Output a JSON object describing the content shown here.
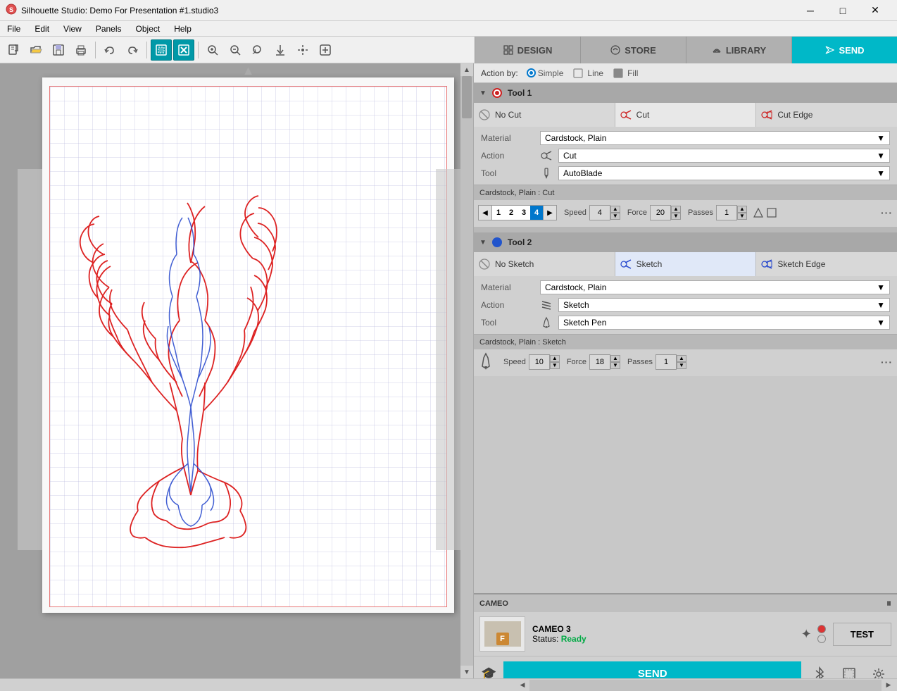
{
  "titlebar": {
    "title": "Silhouette Studio: Demo For Presentation #1.studio3",
    "minimize": "─",
    "maximize": "□",
    "close": "✕"
  },
  "menubar": {
    "items": [
      "File",
      "Edit",
      "View",
      "Panels",
      "Object",
      "Help"
    ]
  },
  "toolbar": {
    "buttons": [
      "new",
      "open",
      "save",
      "print",
      "undo",
      "redo",
      "select",
      "deselect",
      "zoom-in",
      "zoom-out",
      "zoom-fit",
      "move-down",
      "pan",
      "add"
    ]
  },
  "topnav": {
    "tabs": [
      {
        "id": "design",
        "label": "DESIGN",
        "icon": "grid"
      },
      {
        "id": "store",
        "label": "STORE",
        "icon": "store"
      },
      {
        "id": "library",
        "label": "LIBRARY",
        "icon": "cloud"
      },
      {
        "id": "send",
        "label": "SEND",
        "icon": "send",
        "active": true
      }
    ]
  },
  "action_by": {
    "label": "Action by:",
    "options": [
      "Simple",
      "Line",
      "Fill"
    ],
    "active": "Simple"
  },
  "tool1": {
    "header": "Tool 1",
    "cut_options": [
      {
        "id": "no-cut",
        "label": "No Cut"
      },
      {
        "id": "cut",
        "label": "Cut",
        "selected": true
      },
      {
        "id": "cut-edge",
        "label": "Cut Edge"
      }
    ],
    "material_label": "Material",
    "material_value": "Cardstock, Plain",
    "action_label": "Action",
    "action_value": "Cut",
    "tool_label": "Tool",
    "tool_value": "AutoBlade",
    "settings_label": "Cardstock, Plain : Cut",
    "speed_label": "Speed",
    "speed_value": "4",
    "force_label": "Force",
    "force_value": "20",
    "passes_label": "Passes",
    "passes_value": "1",
    "depth_levels": [
      "1",
      "2",
      "3",
      "4"
    ],
    "active_depth": "4"
  },
  "tool2": {
    "header": "Tool 2",
    "sketch_options": [
      {
        "id": "no-sketch",
        "label": "No Sketch"
      },
      {
        "id": "sketch",
        "label": "Sketch",
        "selected": true
      },
      {
        "id": "sketch-edge",
        "label": "Sketch Edge"
      }
    ],
    "material_label": "Material",
    "material_value": "Cardstock, Plain",
    "action_label": "Action",
    "action_value": "Sketch",
    "tool_label": "Tool",
    "tool_value": "Sketch Pen",
    "settings_label": "Cardstock, Plain : Sketch",
    "speed_label": "Speed",
    "speed_value": "10",
    "force_label": "Force",
    "force_value": "18",
    "passes_label": "Passes",
    "passes_value": "1"
  },
  "cameo": {
    "section_label": "CAMEO",
    "device_name": "CAMEO 3",
    "status_prefix": "Status:",
    "status_value": "Ready",
    "test_label": "TEST",
    "send_label": "SEND",
    "pause_icon": "⏸"
  }
}
